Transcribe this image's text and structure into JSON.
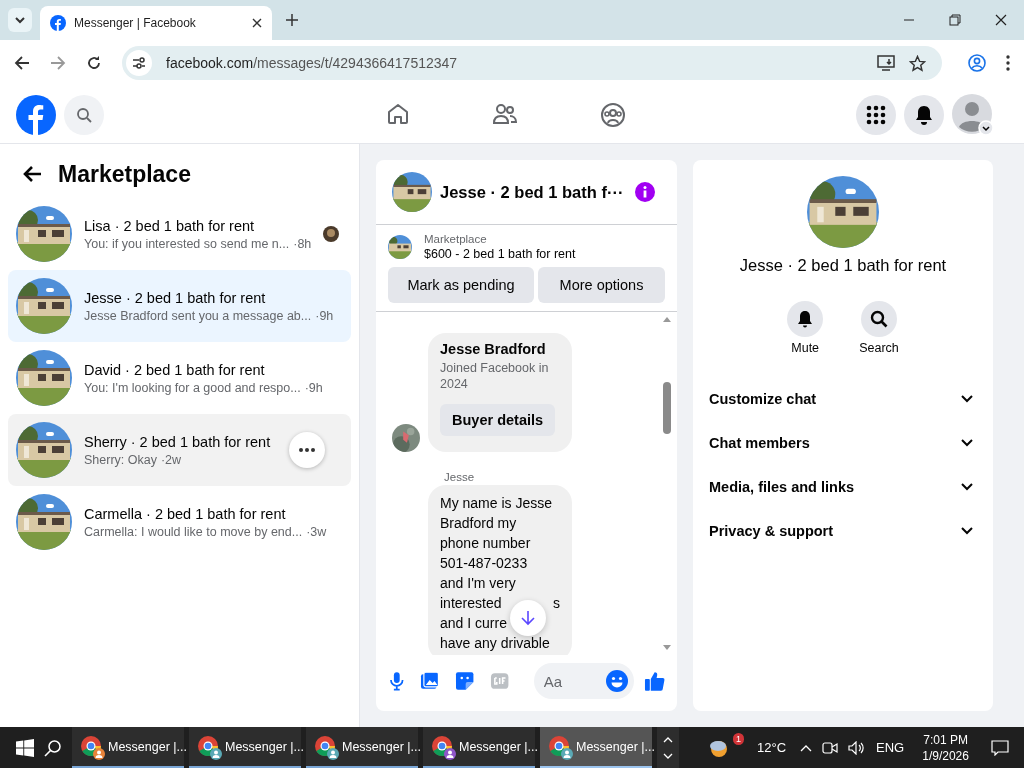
{
  "browser": {
    "tab_title": "Messenger | Facebook",
    "url_host": "facebook.com",
    "url_path": "/messages/t/4294366417512347"
  },
  "conversations": {
    "title": "Marketplace",
    "items": [
      {
        "name": "Lisa · 2 bed 1 bath for rent",
        "preview": "You: if you interested so send me n...",
        "time": "·8h",
        "selected": false,
        "hovered": false,
        "read_receipt": true
      },
      {
        "name": "Jesse · 2 bed 1 bath for rent",
        "preview": "Jesse Bradford sent you a message ab...",
        "time": "·9h",
        "selected": true,
        "hovered": false,
        "read_receipt": false
      },
      {
        "name": "David · 2 bed 1 bath for rent",
        "preview": "You: I'm looking for a good and respo...",
        "time": "·9h",
        "selected": false,
        "hovered": false,
        "read_receipt": false
      },
      {
        "name": "Sherry · 2 bed 1 bath for rent",
        "preview": "Sherry: Okay",
        "time": "·2w",
        "selected": false,
        "hovered": true,
        "read_receipt": false
      },
      {
        "name": "Carmella · 2 bed 1 bath for rent",
        "preview": "Carmella: I would like to move by end...",
        "time": "·3w",
        "selected": false,
        "hovered": false,
        "read_receipt": false
      }
    ]
  },
  "chat": {
    "title": "Jesse · 2 bed 1 bath f···",
    "listing": {
      "source": "Marketplace",
      "title": "$600 - 2 bed 1 bath for rent"
    },
    "actions": [
      "Mark as pending",
      "More options"
    ],
    "messages": [
      {
        "kind": "profile_card",
        "name": "Jesse Bradford",
        "subtitle": "Joined Facebook in 2024",
        "button": "Buyer details"
      },
      {
        "kind": "text",
        "sender": "Jesse",
        "lines": [
          {
            "text": "My name is Jesse"
          },
          {
            "text": "Bradford my"
          },
          {
            "text": "phone number"
          },
          {
            "text": "501-487-0233"
          },
          {
            "text": "and I'm very"
          },
          {
            "text": "interested",
            "tail": "s"
          },
          {
            "text": "and I curre"
          },
          {
            "text": "have any drivable"
          }
        ]
      }
    ],
    "composer": {
      "placeholder": "Aa"
    }
  },
  "details": {
    "title": "Jesse · 2 bed 1 bath for rent",
    "actions": [
      {
        "kind": "mute",
        "label": "Mute"
      },
      {
        "kind": "search",
        "label": "Search"
      }
    ],
    "sections": [
      "Customize chat",
      "Chat members",
      "Media, files and links",
      "Privacy & support"
    ]
  },
  "taskbar": {
    "apps": [
      {
        "label": "Messenger |...",
        "color": "#e8833a",
        "selected": false
      },
      {
        "label": "Messenger |...",
        "color": "#5aa9b5",
        "selected": false
      },
      {
        "label": "Messenger |...",
        "color": "#5aa9b5",
        "selected": false
      },
      {
        "label": "Messenger |...",
        "color": "#8e55c8",
        "selected": false
      },
      {
        "label": "Messenger |...",
        "color": "#5aa9b5",
        "selected": true
      }
    ],
    "weather_badge": "1",
    "temperature": "12°C",
    "language": "ENG",
    "time": "7:01 PM",
    "date": "1/9/2026"
  }
}
